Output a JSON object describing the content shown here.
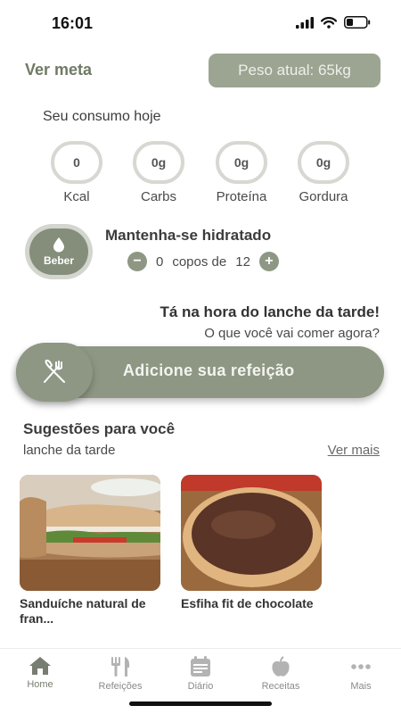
{
  "status": {
    "time": "16:01"
  },
  "header": {
    "ver_meta": "Ver meta",
    "peso_atual": "Peso atual: 65kg"
  },
  "consumo": {
    "title": "Seu consumo hoje",
    "macros": [
      {
        "value": "0",
        "label": "Kcal"
      },
      {
        "value": "0g",
        "label": "Carbs"
      },
      {
        "value": "0g",
        "label": "Proteína"
      },
      {
        "value": "0g",
        "label": "Gordura"
      }
    ]
  },
  "hidratacao": {
    "button_label": "Beber",
    "title": "Mantenha-se hidratado",
    "copos_atual": "0",
    "copos_de": "copos de",
    "copos_meta": "12",
    "minus": "−",
    "plus": "+"
  },
  "refeicao": {
    "prompt_title": "Tá na hora do lanche da tarde!",
    "prompt_sub": "O que você vai comer agora?",
    "add_label": "Adicione sua refeição"
  },
  "sugestoes": {
    "title": "Sugestões para você",
    "subtitle": "lanche da tarde",
    "ver_mais": "Ver mais",
    "items": [
      {
        "title": "Sanduíche natural de fran..."
      },
      {
        "title": "Esfiha fit de chocolate"
      }
    ]
  },
  "nav": {
    "items": [
      {
        "label": "Home",
        "icon": "home-icon"
      },
      {
        "label": "Refeições",
        "icon": "cutlery-icon"
      },
      {
        "label": "Diário",
        "icon": "calendar-icon"
      },
      {
        "label": "Receitas",
        "icon": "apple-icon"
      },
      {
        "label": "Mais",
        "icon": "more-icon"
      }
    ]
  },
  "colors": {
    "accent": "#8e9784",
    "accent_light": "#9ca592"
  }
}
